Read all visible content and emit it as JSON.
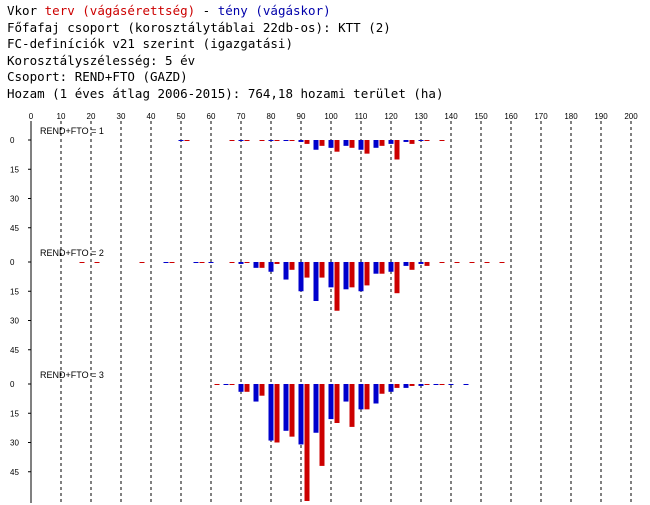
{
  "header": {
    "line1_prefix": "Vkor ",
    "line1_plan": "terv (vágásérettség)",
    "line1_sep": " - ",
    "line1_actual": "tény (vágáskor)",
    "lines": [
      "Főfafaj csoport (korosztálytáblai 22db-os): KTT (2)",
      "FC-definíciók v21 szerint (igazgatási)",
      "Korosztályszélesség: 5 év",
      "Csoport: REND+FTO (GAZD)",
      "Hozam (1 éves átlag 2006-2015): 764,18 hozami terület (ha)"
    ]
  },
  "colors": {
    "plan": "#cc0000",
    "actual": "#0000cc",
    "grid": "#000000"
  },
  "chart_data": {
    "type": "bar",
    "x_ticks": [
      0,
      10,
      20,
      30,
      40,
      50,
      60,
      70,
      80,
      90,
      100,
      110,
      120,
      130,
      140,
      150,
      160,
      170,
      180,
      190,
      200
    ],
    "y_ticks": [
      0,
      15,
      30,
      45
    ],
    "grid": "dashed vertical",
    "panels": [
      {
        "label": "REND+FTO = 1",
        "ylim": [
          0,
          45
        ],
        "series": [
          {
            "name": "terv (vágásérettség)",
            "x": [
              52,
              67,
              72,
              77,
              82,
              87,
              92,
              97,
              102,
              107,
              112,
              117,
              122,
              127,
              132,
              137
            ],
            "values": [
              0.3,
              0.3,
              0.3,
              0.3,
              0.5,
              0.5,
              2,
              3,
              6,
              4,
              7,
              3,
              10,
              2,
              0.5,
              0.3
            ]
          },
          {
            "name": "tény (vágáskor)",
            "x": [
              50,
              70,
              80,
              85,
              90,
              95,
              100,
              105,
              110,
              115,
              120,
              125,
              130
            ],
            "values": [
              0.3,
              0.3,
              0.3,
              0.5,
              1,
              5,
              4,
              3,
              5,
              4,
              2,
              1,
              0.5
            ]
          }
        ]
      },
      {
        "label": "REND+FTO = 2",
        "ylim": [
          0,
          45
        ],
        "series": [
          {
            "name": "terv (vágásérettség)",
            "x": [
              17,
              22,
              37,
              47,
              57,
              67,
              72,
              77,
              82,
              87,
              92,
              97,
              102,
              107,
              112,
              117,
              122,
              127,
              132,
              137,
              142,
              147,
              152,
              157
            ],
            "values": [
              0.3,
              0.3,
              0.3,
              0.3,
              0.3,
              0.3,
              0.5,
              3,
              1,
              4,
              8,
              8,
              25,
              13,
              12,
              6,
              16,
              4,
              2,
              0.5,
              0.3,
              0.3,
              0.3,
              0.3
            ]
          },
          {
            "name": "tény (vágáskor)",
            "x": [
              45,
              55,
              60,
              70,
              75,
              80,
              85,
              90,
              95,
              100,
              105,
              110,
              115,
              120,
              125,
              130
            ],
            "values": [
              0.3,
              0.3,
              0.3,
              1,
              3,
              5,
              9,
              15,
              20,
              13,
              14,
              15,
              6,
              5,
              2,
              1
            ]
          }
        ]
      },
      {
        "label": "REND+FTO = 3",
        "ylim": [
          0,
          45
        ],
        "series": [
          {
            "name": "terv (vágásérettség)",
            "x": [
              62,
              67,
              72,
              77,
              82,
              87,
              92,
              97,
              102,
              107,
              112,
              117,
              122,
              127,
              132,
              137
            ],
            "values": [
              0.3,
              0.3,
              4,
              6,
              30,
              27,
              60,
              42,
              20,
              22,
              13,
              5,
              2,
              1,
              0.5,
              0.3
            ]
          },
          {
            "name": "tény (vágáskor)",
            "x": [
              65,
              70,
              75,
              80,
              85,
              90,
              95,
              100,
              105,
              110,
              115,
              120,
              125,
              130,
              135,
              140,
              145
            ],
            "values": [
              0.3,
              4,
              9,
              29,
              24,
              31,
              25,
              18,
              9,
              13,
              10,
              4,
              2,
              1,
              0.5,
              0.3,
              0.3
            ]
          }
        ]
      }
    ]
  }
}
